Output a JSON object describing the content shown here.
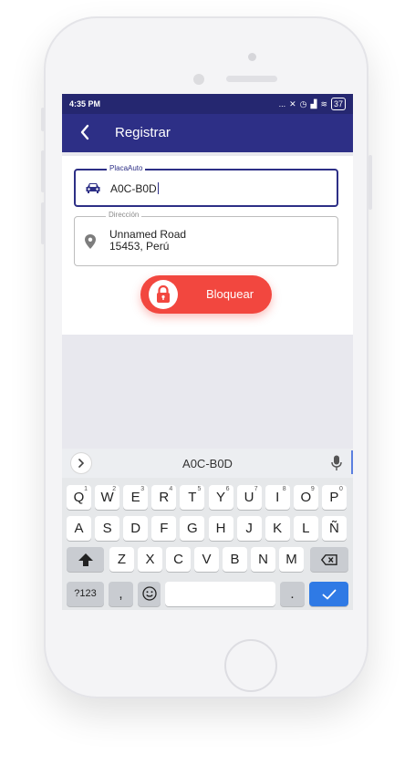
{
  "status_bar": {
    "time": "4:35 PM",
    "icons": [
      "...",
      "✕",
      "◷",
      "▟",
      "≋"
    ],
    "battery": "37"
  },
  "app_bar": {
    "title": "Registrar"
  },
  "form": {
    "plate": {
      "label": "PlacaAuto",
      "value": "A0C-B0D"
    },
    "address": {
      "label": "Dirección",
      "line1": "Unnamed Road",
      "line2": "15453, Perú"
    }
  },
  "lock_button": {
    "label": "Bloquear"
  },
  "keyboard": {
    "suggestion": "A0C-B0D",
    "row1": [
      {
        "k": "Q",
        "h": "1"
      },
      {
        "k": "W",
        "h": "2"
      },
      {
        "k": "E",
        "h": "3"
      },
      {
        "k": "R",
        "h": "4"
      },
      {
        "k": "T",
        "h": "5"
      },
      {
        "k": "Y",
        "h": "6"
      },
      {
        "k": "U",
        "h": "7"
      },
      {
        "k": "I",
        "h": "8"
      },
      {
        "k": "O",
        "h": "9"
      },
      {
        "k": "P",
        "h": "0"
      }
    ],
    "row2": [
      "A",
      "S",
      "D",
      "F",
      "G",
      "H",
      "J",
      "K",
      "L",
      "Ñ"
    ],
    "row3": [
      "Z",
      "X",
      "C",
      "V",
      "B",
      "N",
      "M"
    ],
    "symbols_label": "?123",
    "comma": ",",
    "period": "."
  },
  "colors": {
    "primary": "#2d2f86",
    "status": "#252770",
    "accent": "#f2473f",
    "enter": "#2f7ae5"
  }
}
